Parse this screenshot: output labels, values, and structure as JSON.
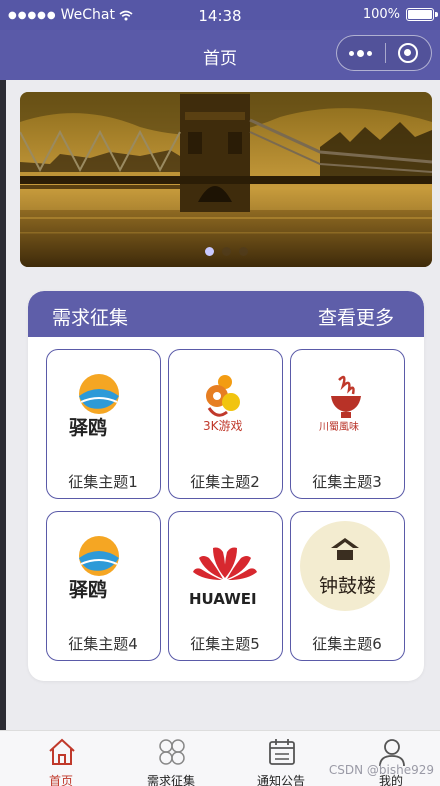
{
  "status_bar": {
    "carrier": "WeChat",
    "time": "14:38",
    "battery": "100%"
  },
  "nav": {
    "title": "首页"
  },
  "banner": {
    "slide_count": 3,
    "active_index": 0
  },
  "section": {
    "title": "需求征集",
    "more_label": "查看更多",
    "items": [
      {
        "label": "征集主题1",
        "logo": "yiou-logo",
        "logo_text": "驿鸥"
      },
      {
        "label": "征集主题2",
        "logo": "3k-games-logo",
        "logo_text": "3K游戏"
      },
      {
        "label": "征集主题3",
        "logo": "chuanshu-fengwei-logo",
        "logo_text": "川蜀風味"
      },
      {
        "label": "征集主题4",
        "logo": "yiou-logo",
        "logo_text": "驿鸥"
      },
      {
        "label": "征集主题5",
        "logo": "huawei-logo",
        "logo_text": "HUAWEI"
      },
      {
        "label": "征集主题6",
        "logo": "zhonggu-lou-logo",
        "logo_text": "钟鼓楼"
      }
    ]
  },
  "tabs": [
    {
      "label": "首页",
      "icon": "home-icon",
      "active": true
    },
    {
      "label": "需求征集",
      "icon": "grid-icon",
      "active": false
    },
    {
      "label": "通知公告",
      "icon": "calendar-icon",
      "active": false
    },
    {
      "label": "我的",
      "icon": "user-icon",
      "active": false
    }
  ],
  "watermark": "CSDN @bishe929",
  "colors": {
    "primary": "#5a5aa8",
    "active_tab": "#c0392b",
    "background": "#ebebef"
  }
}
